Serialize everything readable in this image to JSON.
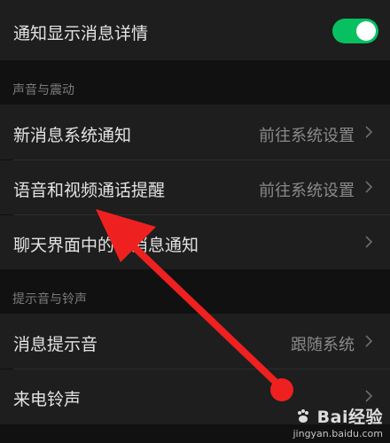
{
  "settings": {
    "show_details": {
      "label": "通知显示消息详情",
      "enabled": true
    },
    "sections": [
      {
        "header": "声音与震动",
        "items": [
          {
            "label": "新消息系统通知",
            "value": "前往系统设置"
          },
          {
            "label": "语音和视频通话提醒",
            "value": "前往系统设置"
          },
          {
            "label": "聊天界面中的新消息通知",
            "value": ""
          }
        ]
      },
      {
        "header": "提示音与铃声",
        "items": [
          {
            "label": "消息提示音",
            "value": "跟随系统"
          },
          {
            "label": "来电铃声",
            "value": ""
          }
        ]
      }
    ]
  },
  "annotation": {
    "color": "#ef2020"
  },
  "watermark": {
    "logo": "Bai经验",
    "url": "jingyan.baidu.com"
  },
  "colors": {
    "background": "#111111",
    "row": "#1e1e1e",
    "toggle_on": "#07c160",
    "muted_text": "#8a8a8a"
  }
}
